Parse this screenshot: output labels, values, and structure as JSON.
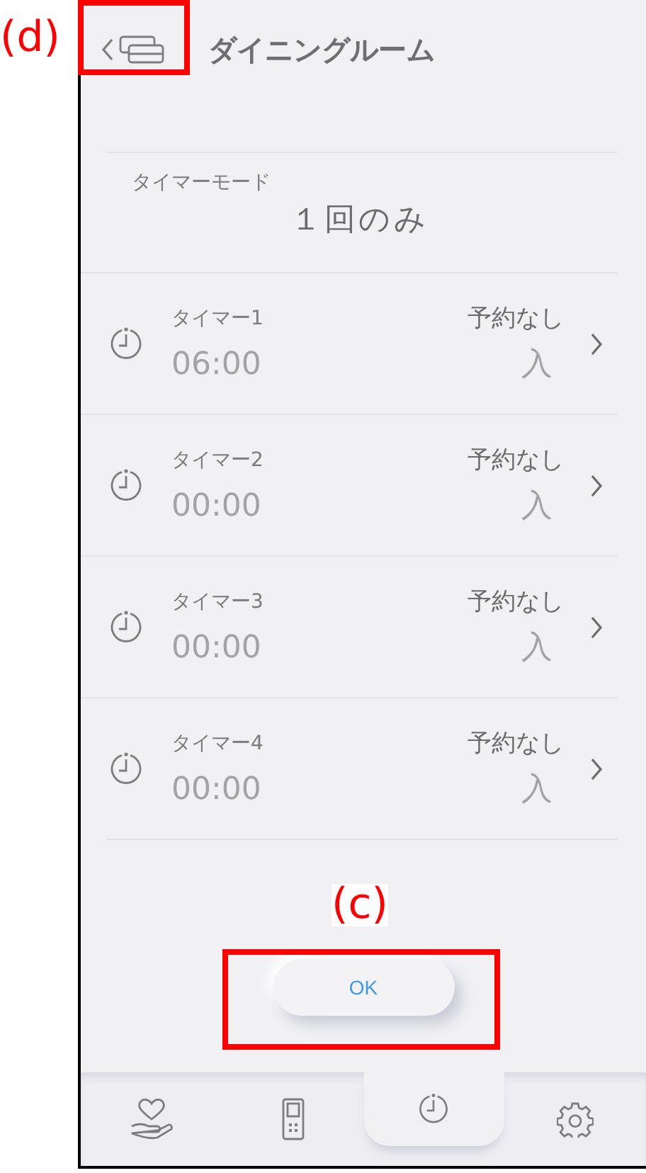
{
  "header": {
    "title": "ダイニングルーム"
  },
  "timer_mode": {
    "label": "タイマーモード",
    "value": "１回のみ"
  },
  "timers": [
    {
      "name": "タイマー1",
      "time": "06:00",
      "reservation": "予約なし",
      "action": "入"
    },
    {
      "name": "タイマー2",
      "time": "00:00",
      "reservation": "予約なし",
      "action": "入"
    },
    {
      "name": "タイマー3",
      "time": "00:00",
      "reservation": "予約なし",
      "action": "入"
    },
    {
      "name": "タイマー4",
      "time": "00:00",
      "reservation": "予約なし",
      "action": "入"
    }
  ],
  "ok_button": "OK",
  "nav": [
    {
      "kind": "care",
      "selected": false
    },
    {
      "kind": "remote",
      "selected": false
    },
    {
      "kind": "timer",
      "selected": true
    },
    {
      "kind": "settings",
      "selected": false
    }
  ],
  "annotations": [
    {
      "label": "(d)"
    },
    {
      "label": "(c)"
    }
  ]
}
